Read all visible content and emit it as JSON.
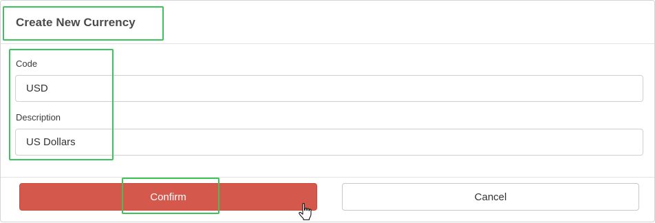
{
  "dialog": {
    "title": "Create New Currency"
  },
  "form": {
    "code": {
      "label": "Code",
      "value": "USD"
    },
    "description": {
      "label": "Description",
      "value": "US Dollars"
    }
  },
  "actions": {
    "confirm_label": "Confirm",
    "cancel_label": "Cancel"
  },
  "colors": {
    "confirm_bg": "#d4584b",
    "highlight": "#3cc35a"
  },
  "icons": {
    "cursor": "hand-pointer-icon"
  }
}
